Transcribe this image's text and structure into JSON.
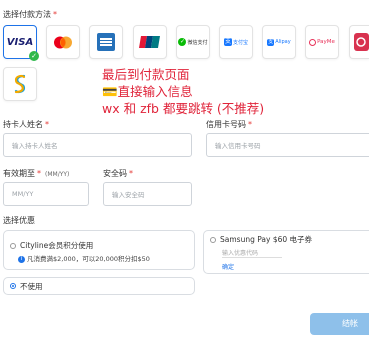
{
  "payment": {
    "title": "选择付款方法",
    "methods": [
      {
        "name": "visa",
        "label": "VISA",
        "selected": true
      },
      {
        "name": "mastercard",
        "label": ""
      },
      {
        "name": "amex",
        "label": ""
      },
      {
        "name": "unionpay",
        "label": ""
      },
      {
        "name": "wechat-pay",
        "label": "微信支付"
      },
      {
        "name": "alipay-hk",
        "label": "支付宝"
      },
      {
        "name": "alipay",
        "label": "Alipay"
      },
      {
        "name": "payme",
        "label": "PayMe"
      },
      {
        "name": "octopus",
        "label": ""
      },
      {
        "name": "fps",
        "label": ""
      }
    ]
  },
  "annotation": {
    "line1": "最后到付款页面",
    "line2": "💳直接输入信息",
    "line3": "wx 和 zfb 都要跳转 (不推荐)"
  },
  "form": {
    "cardholder": {
      "label": "持卡人姓名",
      "placeholder": "输入持卡人姓名"
    },
    "card_number": {
      "label": "信用卡号码",
      "placeholder": "输入信用卡号码"
    },
    "expiry": {
      "label": "有效期至",
      "sub": "(MM/YY)",
      "placeholder": "MM/YY"
    },
    "cvv": {
      "label": "安全码",
      "placeholder": "输入安全码"
    }
  },
  "offers": {
    "title": "选择优惠",
    "cityline": {
      "label": "Cityline会员积分使用",
      "desc": "凡消费满$2,000，可以20,000积分扣$50"
    },
    "samsung": {
      "label": "Samsung Pay $60 电子券",
      "input_placeholder": "输入优惠代码",
      "link": "确定"
    },
    "none": {
      "label": "不使用",
      "selected": true
    }
  },
  "submit": {
    "label": "结帐"
  },
  "colors": {
    "accent": "#1e73e8",
    "required": "#e53935",
    "annotation": "#e0243a",
    "button": "#8ec0ea"
  }
}
